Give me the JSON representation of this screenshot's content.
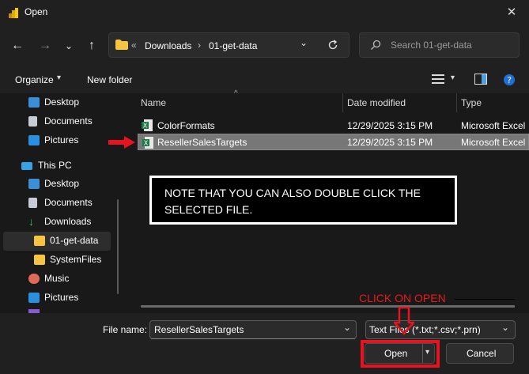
{
  "window": {
    "title": "Open"
  },
  "nav": {
    "breadcrumb_sep": "«",
    "path": [
      "Downloads",
      "01-get-data"
    ],
    "search_placeholder": "Search 01-get-data"
  },
  "toolbar": {
    "organize_label": "Organize",
    "new_folder_label": "New folder"
  },
  "sidebar": {
    "items": [
      {
        "label": "Desktop"
      },
      {
        "label": "Documents"
      },
      {
        "label": "Pictures"
      },
      {
        "label": "This PC"
      },
      {
        "label": "Desktop"
      },
      {
        "label": "Documents"
      },
      {
        "label": "Downloads"
      },
      {
        "label": "01-get-data"
      },
      {
        "label": "SystemFiles"
      },
      {
        "label": "Music"
      },
      {
        "label": "Pictures"
      }
    ]
  },
  "files": {
    "columns": [
      "Name",
      "Date modified",
      "Type"
    ],
    "rows": [
      {
        "name": "ColorFormats",
        "date": "12/29/2025 3:15 PM",
        "type": "Microsoft Excel"
      },
      {
        "name": "ResellerSalesTargets",
        "date": "12/29/2025 3:15 PM",
        "type": "Microsoft Excel"
      }
    ]
  },
  "annotations": {
    "note": "NOTE THAT YOU CAN ALSO DOUBLE CLICK THE SELECTED FILE.",
    "click_open": "CLICK ON OPEN"
  },
  "bottom": {
    "file_name_label": "File name:",
    "file_name_value": "ResellerSalesTargets",
    "filter_value": "Text Files (*.txt;*.csv;*.prn)",
    "open_label": "Open",
    "cancel_label": "Cancel"
  },
  "colors": {
    "accent_red": "#e8131f",
    "excel_green": "#1d7a45",
    "folder_yellow": "#f5c542"
  }
}
